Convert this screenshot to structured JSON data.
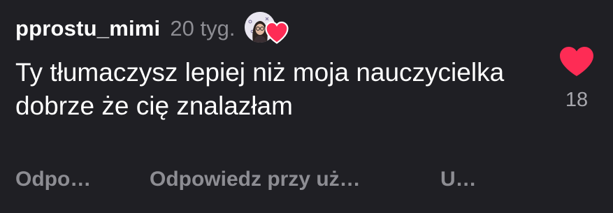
{
  "comment": {
    "username": "pprostu_mimi",
    "time_ago": "20 tyg.",
    "text": "Ty tłumaczysz lepiej niż moja nauczycielka dobrze że cię znalazłam",
    "like_count": "18",
    "like_icon": "heart-icon",
    "liked": true,
    "badge_icons": [
      "creator-avatar",
      "heart-icon"
    ]
  },
  "actions": {
    "reply": "Odpo…",
    "reply_with_video": "Odpowiedz przy uż…",
    "more": "U…"
  },
  "colors": {
    "background": "#1f1f24",
    "heart": "#fe2c55",
    "muted_text": "#8d8d93"
  }
}
